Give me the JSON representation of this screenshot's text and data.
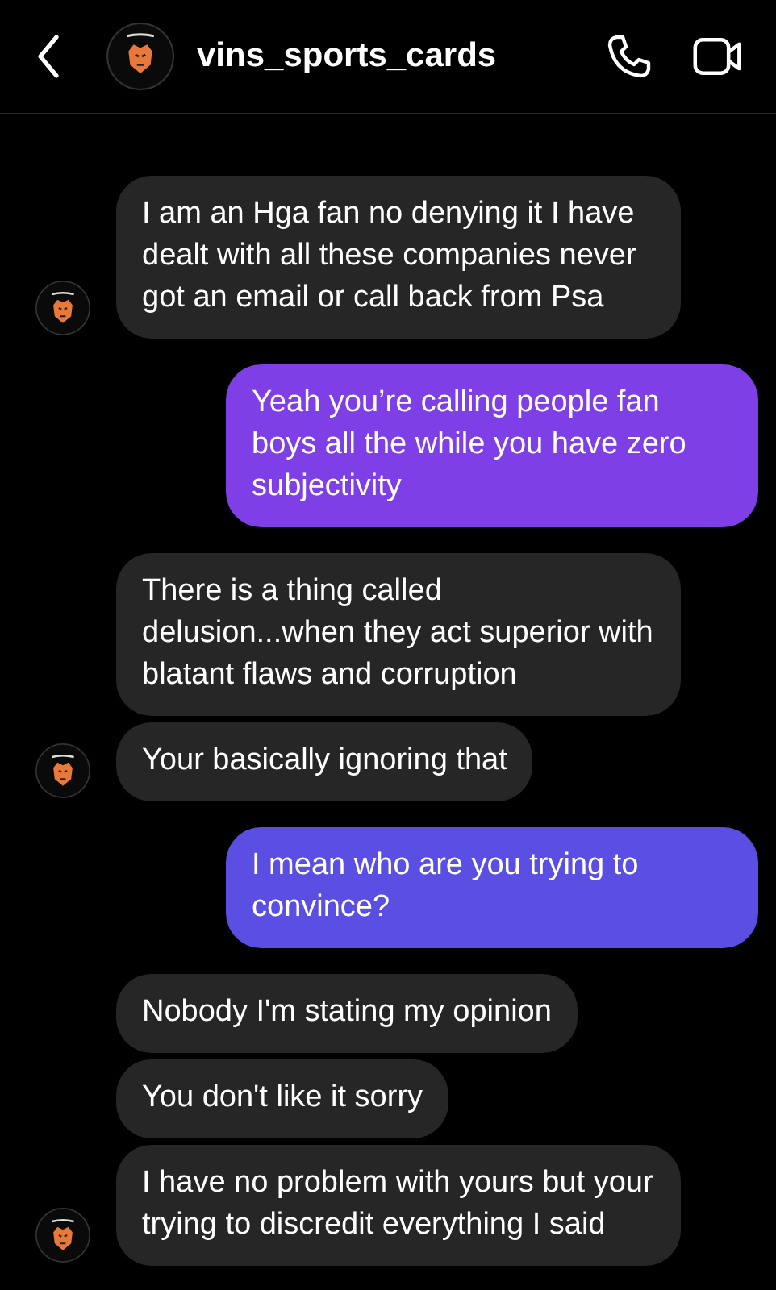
{
  "header": {
    "username": "vins_sports_cards"
  },
  "groups": [
    {
      "kind": "incoming",
      "messages": [
        {
          "text": "I am an Hga fan no denying it I have dealt with all these companies never got an email or call back from Psa"
        }
      ]
    },
    {
      "kind": "outgoing",
      "messages": [
        {
          "text": "Yeah you’re calling people fan boys all the while you have zero subjectivity",
          "color": "#7e3fe6"
        }
      ]
    },
    {
      "kind": "incoming",
      "messages": [
        {
          "text": "There is a thing called delusion...when they act superior with blatant flaws and corruption"
        },
        {
          "text": "Your basically ignoring that"
        }
      ]
    },
    {
      "kind": "outgoing",
      "messages": [
        {
          "text": "I mean who are you trying to convince?",
          "color": "#5a4fe2"
        }
      ]
    },
    {
      "kind": "incoming",
      "messages": [
        {
          "text": "Nobody I'm stating my opinion"
        },
        {
          "text": "You don't like it sorry"
        },
        {
          "text": "I have no problem with yours but your trying to discredit everything I said"
        }
      ]
    }
  ]
}
